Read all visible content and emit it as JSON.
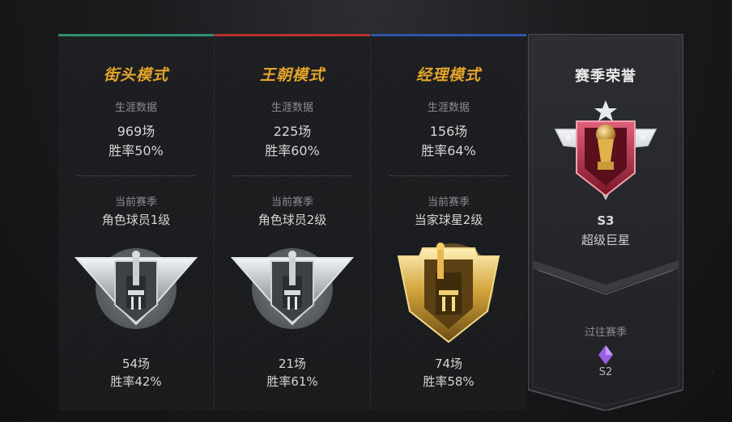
{
  "modes": [
    {
      "title": "街头模式",
      "accent": "#2f8f6f",
      "career_label": "生涯数据",
      "career_games": "969场",
      "career_winrate": "胜率50%",
      "season_label": "当前赛季",
      "season_rank": "角色球员1级",
      "badge_icon": "silver-rank-badge-icon",
      "season_games": "54场",
      "season_winrate": "胜率42%"
    },
    {
      "title": "王朝模式",
      "accent": "#b8342e",
      "career_label": "生涯数据",
      "career_games": "225场",
      "career_winrate": "胜率60%",
      "season_label": "当前赛季",
      "season_rank": "角色球员2级",
      "badge_icon": "silver-rank-badge-icon",
      "season_games": "21场",
      "season_winrate": "胜率61%"
    },
    {
      "title": "经理模式",
      "accent": "#2e55a8",
      "career_label": "生涯数据",
      "career_games": "156场",
      "career_winrate": "胜率64%",
      "season_label": "当前赛季",
      "season_rank": "当家球星2级",
      "badge_icon": "gold-rank-badge-icon",
      "season_games": "74场",
      "season_winrate": "胜率58%"
    }
  ],
  "honor": {
    "title": "赛季荣誉",
    "badge_icon": "trophy-badge-icon",
    "season": "S3",
    "rank": "超级巨星",
    "past_label": "过往赛季",
    "past_icon": "purple-diamond-icon",
    "past_season": "S2"
  }
}
